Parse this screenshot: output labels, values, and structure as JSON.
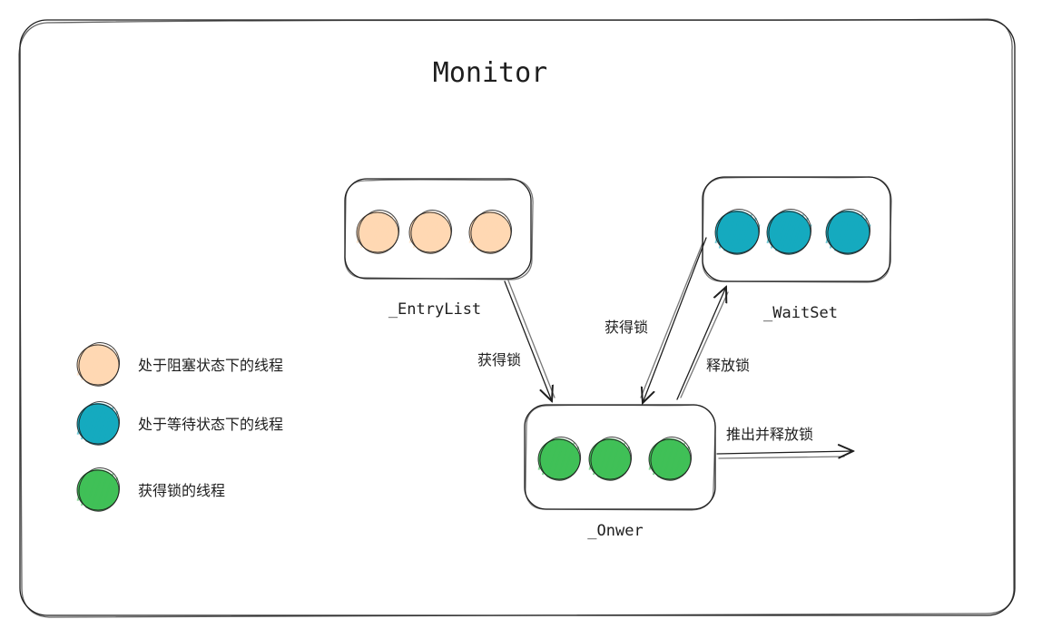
{
  "title": "Monitor",
  "colors": {
    "blocked": "#ffd8b3",
    "waiting": "#15aabf",
    "owner": "#40c057",
    "stroke": "#1e1e1e"
  },
  "boxes": {
    "entry_list": {
      "label": "_EntryList",
      "thread_count": 3,
      "state": "blocked"
    },
    "wait_set": {
      "label": "_WaitSet",
      "thread_count": 3,
      "state": "waiting"
    },
    "owner": {
      "label": "_Onwer",
      "thread_count": 3,
      "state": "owner"
    }
  },
  "arrows": {
    "entry_to_owner": "获得锁",
    "waitset_to_owner": "获得锁",
    "owner_to_waitset": "释放锁",
    "owner_exit": "推出并释放锁"
  },
  "legend": [
    {
      "state": "blocked",
      "label": "处于阻塞状态下的线程"
    },
    {
      "state": "waiting",
      "label": "处于等待状态下的线程"
    },
    {
      "state": "owner",
      "label": "获得锁的线程"
    }
  ]
}
